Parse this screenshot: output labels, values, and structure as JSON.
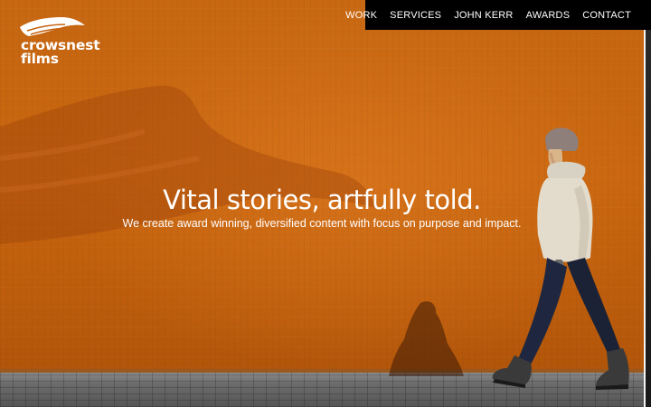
{
  "nav": {
    "items": [
      {
        "label": "WORK"
      },
      {
        "label": "SERVICES"
      },
      {
        "label": "JOHN KERR"
      },
      {
        "label": "AWARDS"
      },
      {
        "label": "CONTACT"
      }
    ]
  },
  "logo": {
    "line1": "crowsnest",
    "line2": "films"
  },
  "hero": {
    "headline": "Vital stories, artfully told.",
    "subheadline": "We create award winning, diversified content with focus on purpose and impact."
  },
  "colors": {
    "background_orange": "#c4600f",
    "nav_background": "#000000",
    "text": "#ffffff"
  }
}
